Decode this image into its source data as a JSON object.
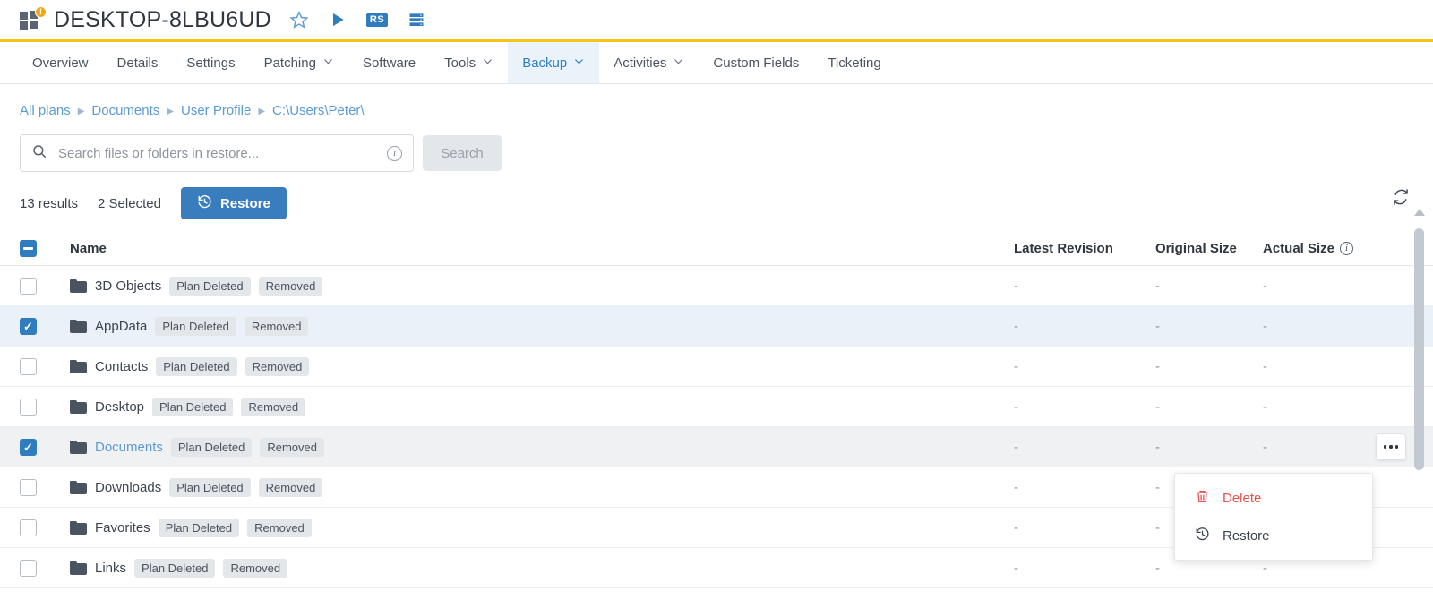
{
  "header": {
    "device_name": "DESKTOP-8LBU6UD",
    "os_icon": "windows-logo-icon",
    "badge_text": "!",
    "icons": [
      {
        "name": "favorite-star-icon",
        "glyph": "☆"
      },
      {
        "name": "run-play-icon",
        "glyph": "▶"
      },
      {
        "name": "remote-session-icon",
        "label": "RS"
      },
      {
        "name": "server-stack-icon",
        "glyph": "▤"
      }
    ],
    "accent_bar_color": "#f5c518"
  },
  "tabs": [
    {
      "label": "Overview",
      "has_chevron": false,
      "active": false
    },
    {
      "label": "Details",
      "has_chevron": false,
      "active": false
    },
    {
      "label": "Settings",
      "has_chevron": false,
      "active": false
    },
    {
      "label": "Patching",
      "has_chevron": true,
      "active": false
    },
    {
      "label": "Software",
      "has_chevron": false,
      "active": false
    },
    {
      "label": "Tools",
      "has_chevron": true,
      "active": false
    },
    {
      "label": "Backup",
      "has_chevron": true,
      "active": true
    },
    {
      "label": "Activities",
      "has_chevron": true,
      "active": false
    },
    {
      "label": "Custom Fields",
      "has_chevron": false,
      "active": false
    },
    {
      "label": "Ticketing",
      "has_chevron": false,
      "active": false
    }
  ],
  "breadcrumb": [
    "All plans",
    "Documents",
    "User Profile",
    "C:\\Users\\Peter\\"
  ],
  "search": {
    "placeholder": "Search files or folders in restore...",
    "value": "",
    "info_glyph": "i",
    "button_label": "Search",
    "button_disabled": true
  },
  "toolbar": {
    "results_label": "13 results",
    "selected_label": "2 Selected",
    "restore_label": "Restore",
    "refresh_icon": "refresh-icon"
  },
  "table": {
    "columns": [
      {
        "key": "name",
        "label": "Name"
      },
      {
        "key": "latest_revision",
        "label": "Latest Revision"
      },
      {
        "key": "original_size",
        "label": "Original Size"
      },
      {
        "key": "actual_size",
        "label": "Actual Size",
        "has_info": true
      }
    ],
    "header_checkbox_state": "indeterminate",
    "rows": [
      {
        "name": "3D Objects",
        "badges": [
          "Plan Deleted",
          "Removed"
        ],
        "latest_revision": "-",
        "original_size": "-",
        "actual_size": "-",
        "checked": false,
        "selected": false,
        "hovered": false,
        "link": false
      },
      {
        "name": "AppData",
        "badges": [
          "Plan Deleted",
          "Removed"
        ],
        "latest_revision": "-",
        "original_size": "-",
        "actual_size": "-",
        "checked": true,
        "selected": true,
        "hovered": false,
        "link": false
      },
      {
        "name": "Contacts",
        "badges": [
          "Plan Deleted",
          "Removed"
        ],
        "latest_revision": "-",
        "original_size": "-",
        "actual_size": "-",
        "checked": false,
        "selected": false,
        "hovered": false,
        "link": false
      },
      {
        "name": "Desktop",
        "badges": [
          "Plan Deleted",
          "Removed"
        ],
        "latest_revision": "-",
        "original_size": "-",
        "actual_size": "-",
        "checked": false,
        "selected": false,
        "hovered": false,
        "link": false
      },
      {
        "name": "Documents",
        "badges": [
          "Plan Deleted",
          "Removed"
        ],
        "latest_revision": "-",
        "original_size": "-",
        "actual_size": "-",
        "checked": true,
        "selected": false,
        "hovered": true,
        "link": true,
        "kebab": true
      },
      {
        "name": "Downloads",
        "badges": [
          "Plan Deleted",
          "Removed"
        ],
        "latest_revision": "-",
        "original_size": "-",
        "actual_size": "-",
        "checked": false,
        "selected": false,
        "hovered": false,
        "link": false
      },
      {
        "name": "Favorites",
        "badges": [
          "Plan Deleted",
          "Removed"
        ],
        "latest_revision": "-",
        "original_size": "-",
        "actual_size": "-",
        "checked": false,
        "selected": false,
        "hovered": false,
        "link": false
      },
      {
        "name": "Links",
        "badges": [
          "Plan Deleted",
          "Removed"
        ],
        "latest_revision": "-",
        "original_size": "-",
        "actual_size": "-",
        "checked": false,
        "selected": false,
        "hovered": false,
        "link": false
      }
    ]
  },
  "context_menu": {
    "items": [
      {
        "label": "Delete",
        "icon": "trash-icon",
        "danger": true
      },
      {
        "label": "Restore",
        "icon": "restore-clock-icon",
        "danger": false
      }
    ]
  },
  "colors": {
    "accent_yellow": "#f5c518",
    "primary_blue": "#2f7dc0",
    "restore_blue": "#3a7dbf",
    "link_blue": "#5b9bd5",
    "danger_red": "#e0534e",
    "selected_row": "#eaf1f8",
    "hover_row": "#f0f1f3",
    "badge_bg": "#e4e7ea",
    "folder_gray": "#4a5460"
  }
}
